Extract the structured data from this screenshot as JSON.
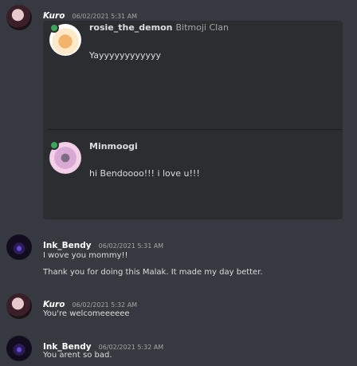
{
  "messages": [
    {
      "author": "Kuro",
      "timestamp": "06/02/2021 5:31 AM",
      "embed": {
        "posts": [
          {
            "author": "rosie_the_demon",
            "tag": "Bitmoji Clan",
            "text": "Yayyyyyyyyyyyy"
          },
          {
            "author": "Minmoogi",
            "text": "hi Bendoooo!!! i love u!!!"
          }
        ]
      }
    },
    {
      "author": "Ink_Bendy",
      "timestamp": "06/02/2021 5:31 AM",
      "lines": [
        "I wove you mommy!!",
        "Thank you for doing this Malak. It made my day better."
      ]
    },
    {
      "author": "Kuro",
      "timestamp": "06/02/2021 5:32 AM",
      "lines": [
        "You're welcomeeeeee"
      ]
    },
    {
      "author": "Ink_Bendy",
      "timestamp": "06/02/2021 5:32 AM",
      "lines": [
        "You arent so bad."
      ]
    }
  ],
  "colors": {
    "background": "#36393f",
    "embed_background": "#2b2d31",
    "online": "#3ba55c"
  },
  "icons": {
    "status": "online-status-icon"
  }
}
